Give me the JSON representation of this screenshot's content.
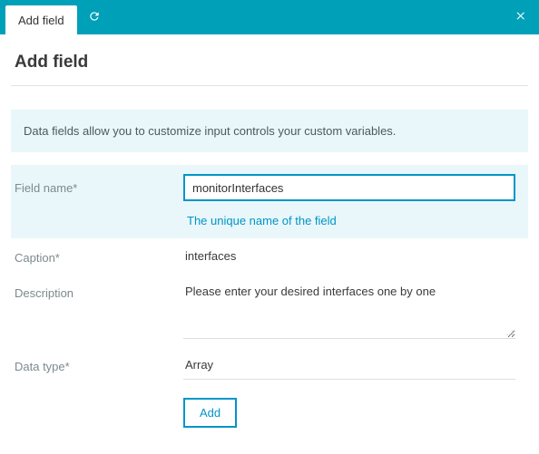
{
  "topbar": {
    "tab_label": "Add field"
  },
  "page": {
    "title": "Add field",
    "info": "Data fields allow you to customize input controls your custom variables."
  },
  "form": {
    "field_name": {
      "label": "Field name*",
      "value": "monitorInterfaces",
      "help": "The unique name of the field"
    },
    "caption": {
      "label": "Caption*",
      "value": "interfaces"
    },
    "description": {
      "label": "Description",
      "value": "Please enter your desired interfaces one by one"
    },
    "data_type": {
      "label": "Data type*",
      "value": "Array"
    },
    "add_button": "Add"
  }
}
